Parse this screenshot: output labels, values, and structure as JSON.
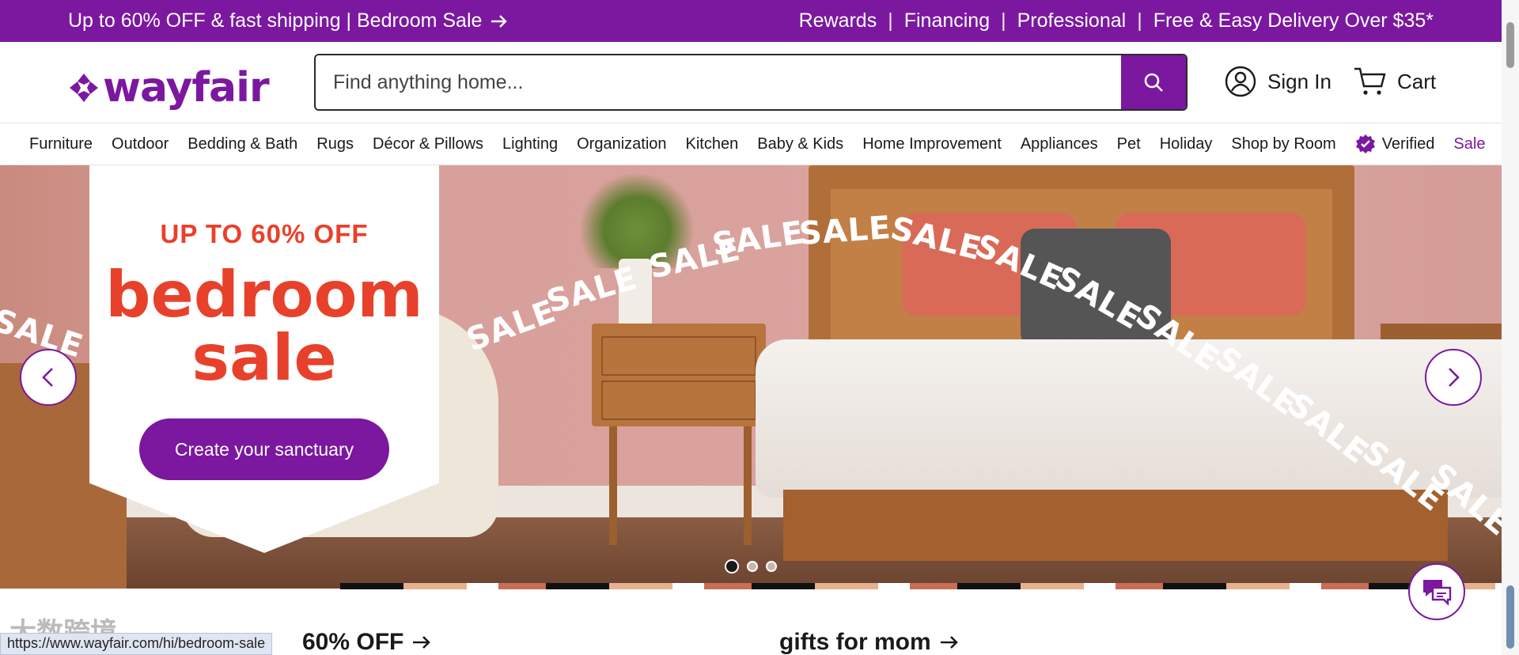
{
  "promo_bar": {
    "left_text": "Up to 60% OFF & fast shipping | Bedroom Sale",
    "links": [
      "Rewards",
      "Financing",
      "Professional",
      "Free & Easy Delivery Over $35*"
    ]
  },
  "header": {
    "logo_text": "wayfair",
    "search_placeholder": "Find anything home...",
    "sign_in": "Sign In",
    "cart": "Cart"
  },
  "categories": [
    "Furniture",
    "Outdoor",
    "Bedding & Bath",
    "Rugs",
    "Décor & Pillows",
    "Lighting",
    "Organization",
    "Kitchen",
    "Baby & Kids",
    "Home Improvement",
    "Appliances",
    "Pet",
    "Holiday",
    "Shop by Room"
  ],
  "verified_label": "Verified",
  "sale_label": "Sale",
  "hero": {
    "kicker": "UP TO 60% OFF",
    "title_line1": "bedroom",
    "title_line2": "sale",
    "cta": "Create your sanctuary",
    "sale_word": "SALE",
    "slide_count": 3,
    "active_slide": 1
  },
  "sections": {
    "left_title": "60% OFF",
    "right_title": "gifts for mom"
  },
  "status_url": "https://www.wayfair.com/hi/bedroom-sale",
  "watermark_text": "大数跨境",
  "colors": {
    "brand": "#7b189f",
    "accent_red": "#e8412b"
  }
}
